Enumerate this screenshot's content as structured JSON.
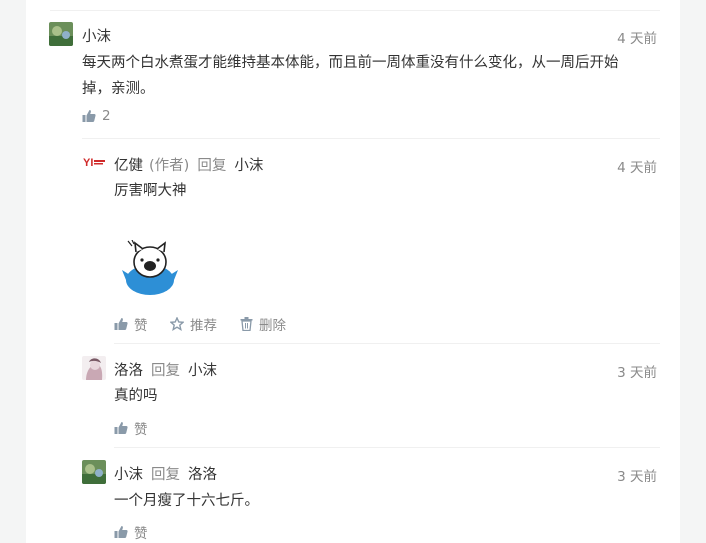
{
  "colors": {
    "text": "#333333",
    "muted": "#8a8a8a",
    "divider": "#f0f0f0",
    "like": "#8a9aa9"
  },
  "comments": [
    {
      "user": "小沫",
      "time": "4 天前",
      "content_line1": "每天两个白水煮蛋才能维持基本体能，而且前一周体重没有什么变化，从一周后开始",
      "content_line2": "掉，亲测。",
      "like_count": "2"
    }
  ],
  "replies": [
    {
      "user": "亿健",
      "author_tag": "(作者)",
      "reply_label": "回复",
      "target": "小沫",
      "time": "4 天前",
      "content": "厉害啊大神",
      "like_label": "赞",
      "recommend_label": "推荐",
      "delete_label": "删除",
      "avatar_logo_text": "YI"
    },
    {
      "user": "洛洛",
      "reply_label": "回复",
      "target": "小沫",
      "time": "3 天前",
      "content": "真的吗",
      "like_label": "赞"
    },
    {
      "user": "小沫",
      "reply_label": "回复",
      "target": "洛洛",
      "time": "3 天前",
      "content": "一个月瘦了十六七斤。",
      "like_label": "赞"
    }
  ]
}
